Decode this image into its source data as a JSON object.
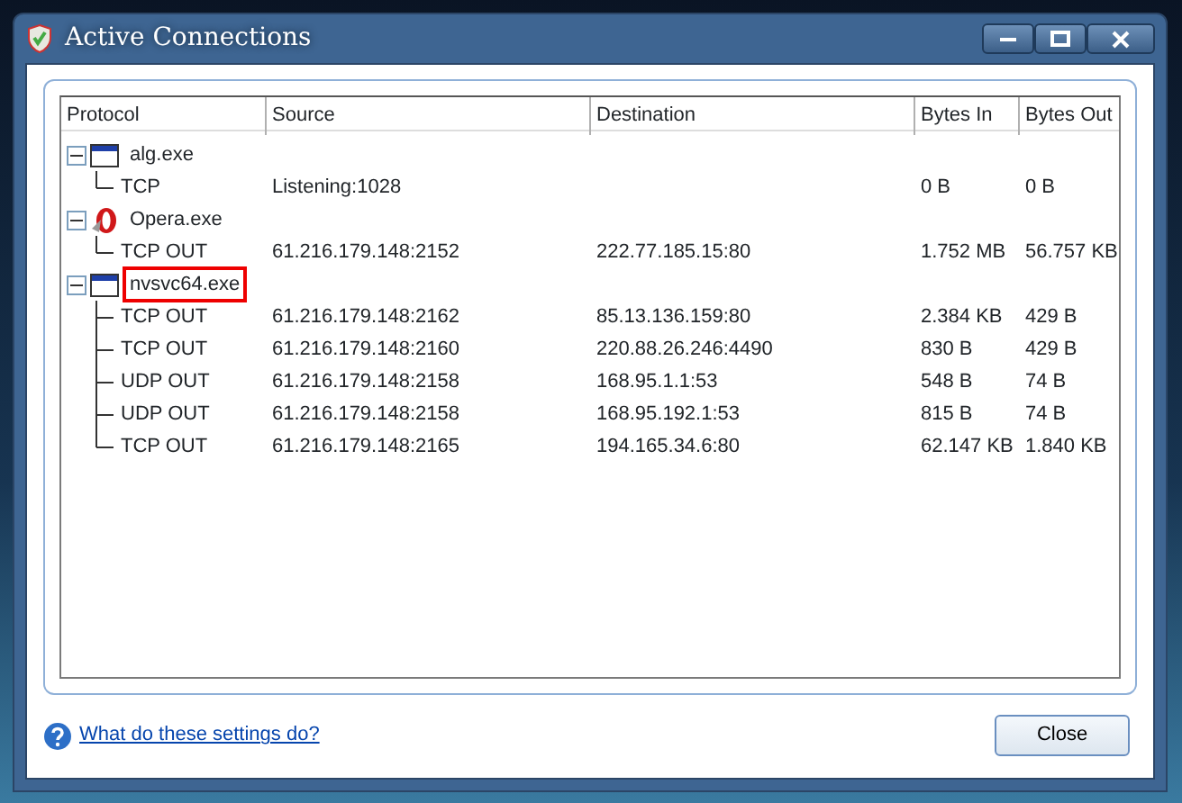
{
  "window": {
    "title": "Active Connections"
  },
  "table": {
    "columns": [
      "Protocol",
      "Source",
      "Destination",
      "Bytes In",
      "Bytes Out"
    ],
    "processes": [
      {
        "name": "alg.exe",
        "kind": "window",
        "expanded": true,
        "highlighted": false,
        "children": [
          {
            "cells": [
              "TCP",
              "Listening:1028",
              "",
              "0 B",
              "0 B"
            ]
          }
        ]
      },
      {
        "name": "Opera.exe",
        "kind": "opera",
        "expanded": true,
        "highlighted": false,
        "children": [
          {
            "cells": [
              "TCP OUT",
              "61.216.179.148:2152",
              "222.77.185.15:80",
              "1.752 MB",
              "56.757 KB"
            ]
          }
        ]
      },
      {
        "name": "nvsvc64.exe",
        "kind": "window",
        "expanded": true,
        "highlighted": true,
        "children": [
          {
            "cells": [
              "TCP OUT",
              "61.216.179.148:2162",
              "85.13.136.159:80",
              "2.384 KB",
              "429 B"
            ]
          },
          {
            "cells": [
              "TCP OUT",
              "61.216.179.148:2160",
              "220.88.26.246:4490",
              "830 B",
              "429 B"
            ]
          },
          {
            "cells": [
              "UDP OUT",
              "61.216.179.148:2158",
              "168.95.1.1:53",
              "548 B",
              "74 B"
            ]
          },
          {
            "cells": [
              "UDP OUT",
              "61.216.179.148:2158",
              "168.95.192.1:53",
              "815 B",
              "74 B"
            ]
          },
          {
            "cells": [
              "TCP OUT",
              "61.216.179.148:2165",
              "194.165.34.6:80",
              "62.147 KB",
              "1.840 KB"
            ]
          }
        ]
      }
    ]
  },
  "help_link": "What do these settings do?",
  "buttons": [
    "Close"
  ]
}
